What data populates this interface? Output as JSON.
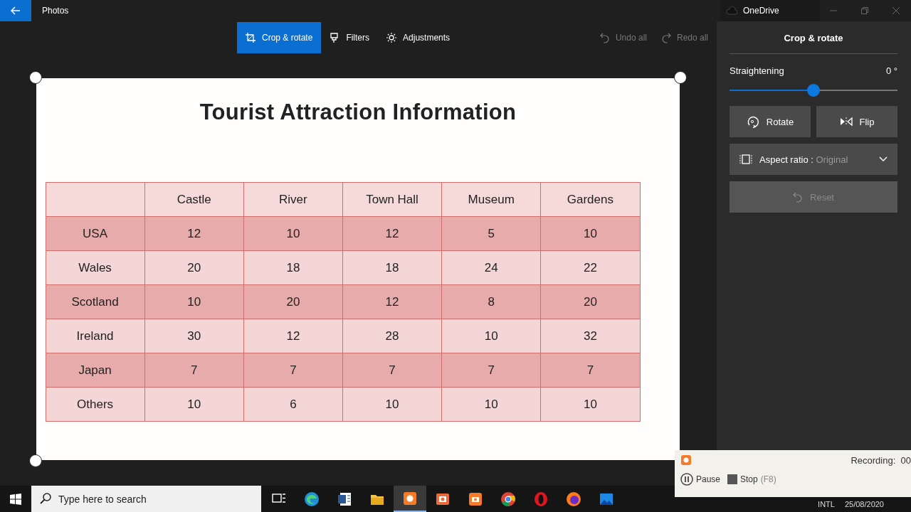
{
  "window": {
    "title": "Photos",
    "other_title": "OneDrive"
  },
  "toolbar": {
    "tabs": [
      {
        "label": "Crop & rotate",
        "kind": "crop",
        "selected": true
      },
      {
        "label": "Filters",
        "kind": "filters",
        "selected": false
      },
      {
        "label": "Adjustments",
        "kind": "adjust",
        "selected": false
      }
    ],
    "actions": [
      {
        "label": "Undo all",
        "kind": "undo"
      },
      {
        "label": "Redo all",
        "kind": "redo"
      }
    ]
  },
  "image": {
    "title": "Tourist Attraction Information",
    "table": {
      "columns": [
        "Castle",
        "River",
        "Town Hall",
        "Museum",
        "Gardens"
      ],
      "rows": [
        {
          "label": "USA",
          "values": [
            "12",
            "10",
            "12",
            "5",
            "10"
          ]
        },
        {
          "label": "Wales",
          "values": [
            "20",
            "18",
            "18",
            "24",
            "22"
          ]
        },
        {
          "label": "Scotland",
          "values": [
            "10",
            "20",
            "12",
            "8",
            "20"
          ]
        },
        {
          "label": "Ireland",
          "values": [
            "30",
            "12",
            "28",
            "10",
            "32"
          ]
        },
        {
          "label": "Japan",
          "values": [
            "7",
            "7",
            "7",
            "7",
            "7"
          ]
        },
        {
          "label": "Others",
          "values": [
            "10",
            "6",
            "10",
            "10",
            "10"
          ]
        }
      ]
    }
  },
  "panel": {
    "title": "Crop & rotate",
    "straightening": {
      "label": "Straightening",
      "reading": "0 °",
      "level": 0.5
    },
    "buttons": [
      {
        "label": "Rotate",
        "kind": "rotate"
      },
      {
        "label": "Flip",
        "kind": "flip"
      }
    ],
    "aspect_ratio": {
      "label": "Aspect ratio :",
      "value": "Original"
    },
    "reset": {
      "label": "Reset",
      "disabled": true
    }
  },
  "taskbar": {
    "search_placeholder": "Type here to search",
    "apps": [
      {
        "kind": "taskview",
        "selected": false
      },
      {
        "kind": "edge",
        "selected": false
      },
      {
        "kind": "word",
        "selected": false
      },
      {
        "kind": "folder",
        "selected": false
      },
      {
        "kind": "recorder",
        "selected": true
      },
      {
        "kind": "slides",
        "selected": false
      },
      {
        "kind": "camera",
        "selected": false
      },
      {
        "kind": "chrome",
        "selected": false
      },
      {
        "kind": "opera",
        "selected": false
      },
      {
        "kind": "firefox",
        "selected": false
      },
      {
        "kind": "photos",
        "selected": false
      }
    ],
    "tray": {
      "language": "INTL",
      "date": "25/08/2020"
    }
  },
  "recorder": {
    "status": "Recording:  00",
    "buttons": [
      {
        "label": "Pause",
        "kind": "pause"
      },
      {
        "label": "Stop",
        "hint": "(F8)",
        "kind": "stop"
      }
    ]
  }
}
